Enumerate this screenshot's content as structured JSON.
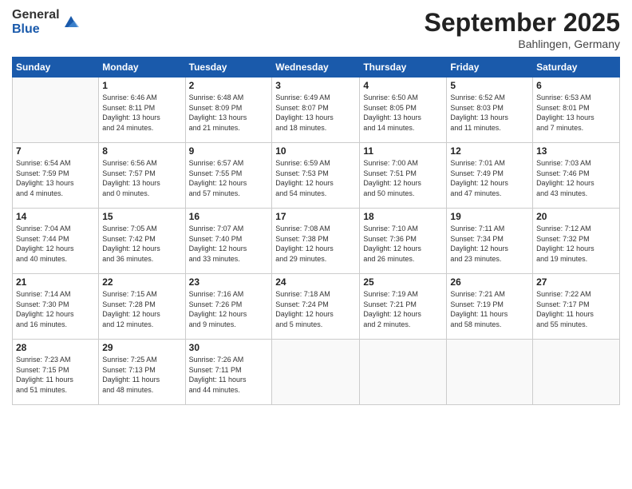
{
  "logo": {
    "general": "General",
    "blue": "Blue"
  },
  "header": {
    "title": "September 2025",
    "location": "Bahlingen, Germany"
  },
  "days_of_week": [
    "Sunday",
    "Monday",
    "Tuesday",
    "Wednesday",
    "Thursday",
    "Friday",
    "Saturday"
  ],
  "weeks": [
    [
      {
        "day": "",
        "info": ""
      },
      {
        "day": "1",
        "info": "Sunrise: 6:46 AM\nSunset: 8:11 PM\nDaylight: 13 hours\nand 24 minutes."
      },
      {
        "day": "2",
        "info": "Sunrise: 6:48 AM\nSunset: 8:09 PM\nDaylight: 13 hours\nand 21 minutes."
      },
      {
        "day": "3",
        "info": "Sunrise: 6:49 AM\nSunset: 8:07 PM\nDaylight: 13 hours\nand 18 minutes."
      },
      {
        "day": "4",
        "info": "Sunrise: 6:50 AM\nSunset: 8:05 PM\nDaylight: 13 hours\nand 14 minutes."
      },
      {
        "day": "5",
        "info": "Sunrise: 6:52 AM\nSunset: 8:03 PM\nDaylight: 13 hours\nand 11 minutes."
      },
      {
        "day": "6",
        "info": "Sunrise: 6:53 AM\nSunset: 8:01 PM\nDaylight: 13 hours\nand 7 minutes."
      }
    ],
    [
      {
        "day": "7",
        "info": "Sunrise: 6:54 AM\nSunset: 7:59 PM\nDaylight: 13 hours\nand 4 minutes."
      },
      {
        "day": "8",
        "info": "Sunrise: 6:56 AM\nSunset: 7:57 PM\nDaylight: 13 hours\nand 0 minutes."
      },
      {
        "day": "9",
        "info": "Sunrise: 6:57 AM\nSunset: 7:55 PM\nDaylight: 12 hours\nand 57 minutes."
      },
      {
        "day": "10",
        "info": "Sunrise: 6:59 AM\nSunset: 7:53 PM\nDaylight: 12 hours\nand 54 minutes."
      },
      {
        "day": "11",
        "info": "Sunrise: 7:00 AM\nSunset: 7:51 PM\nDaylight: 12 hours\nand 50 minutes."
      },
      {
        "day": "12",
        "info": "Sunrise: 7:01 AM\nSunset: 7:49 PM\nDaylight: 12 hours\nand 47 minutes."
      },
      {
        "day": "13",
        "info": "Sunrise: 7:03 AM\nSunset: 7:46 PM\nDaylight: 12 hours\nand 43 minutes."
      }
    ],
    [
      {
        "day": "14",
        "info": "Sunrise: 7:04 AM\nSunset: 7:44 PM\nDaylight: 12 hours\nand 40 minutes."
      },
      {
        "day": "15",
        "info": "Sunrise: 7:05 AM\nSunset: 7:42 PM\nDaylight: 12 hours\nand 36 minutes."
      },
      {
        "day": "16",
        "info": "Sunrise: 7:07 AM\nSunset: 7:40 PM\nDaylight: 12 hours\nand 33 minutes."
      },
      {
        "day": "17",
        "info": "Sunrise: 7:08 AM\nSunset: 7:38 PM\nDaylight: 12 hours\nand 29 minutes."
      },
      {
        "day": "18",
        "info": "Sunrise: 7:10 AM\nSunset: 7:36 PM\nDaylight: 12 hours\nand 26 minutes."
      },
      {
        "day": "19",
        "info": "Sunrise: 7:11 AM\nSunset: 7:34 PM\nDaylight: 12 hours\nand 23 minutes."
      },
      {
        "day": "20",
        "info": "Sunrise: 7:12 AM\nSunset: 7:32 PM\nDaylight: 12 hours\nand 19 minutes."
      }
    ],
    [
      {
        "day": "21",
        "info": "Sunrise: 7:14 AM\nSunset: 7:30 PM\nDaylight: 12 hours\nand 16 minutes."
      },
      {
        "day": "22",
        "info": "Sunrise: 7:15 AM\nSunset: 7:28 PM\nDaylight: 12 hours\nand 12 minutes."
      },
      {
        "day": "23",
        "info": "Sunrise: 7:16 AM\nSunset: 7:26 PM\nDaylight: 12 hours\nand 9 minutes."
      },
      {
        "day": "24",
        "info": "Sunrise: 7:18 AM\nSunset: 7:24 PM\nDaylight: 12 hours\nand 5 minutes."
      },
      {
        "day": "25",
        "info": "Sunrise: 7:19 AM\nSunset: 7:21 PM\nDaylight: 12 hours\nand 2 minutes."
      },
      {
        "day": "26",
        "info": "Sunrise: 7:21 AM\nSunset: 7:19 PM\nDaylight: 11 hours\nand 58 minutes."
      },
      {
        "day": "27",
        "info": "Sunrise: 7:22 AM\nSunset: 7:17 PM\nDaylight: 11 hours\nand 55 minutes."
      }
    ],
    [
      {
        "day": "28",
        "info": "Sunrise: 7:23 AM\nSunset: 7:15 PM\nDaylight: 11 hours\nand 51 minutes."
      },
      {
        "day": "29",
        "info": "Sunrise: 7:25 AM\nSunset: 7:13 PM\nDaylight: 11 hours\nand 48 minutes."
      },
      {
        "day": "30",
        "info": "Sunrise: 7:26 AM\nSunset: 7:11 PM\nDaylight: 11 hours\nand 44 minutes."
      },
      {
        "day": "",
        "info": ""
      },
      {
        "day": "",
        "info": ""
      },
      {
        "day": "",
        "info": ""
      },
      {
        "day": "",
        "info": ""
      }
    ]
  ]
}
